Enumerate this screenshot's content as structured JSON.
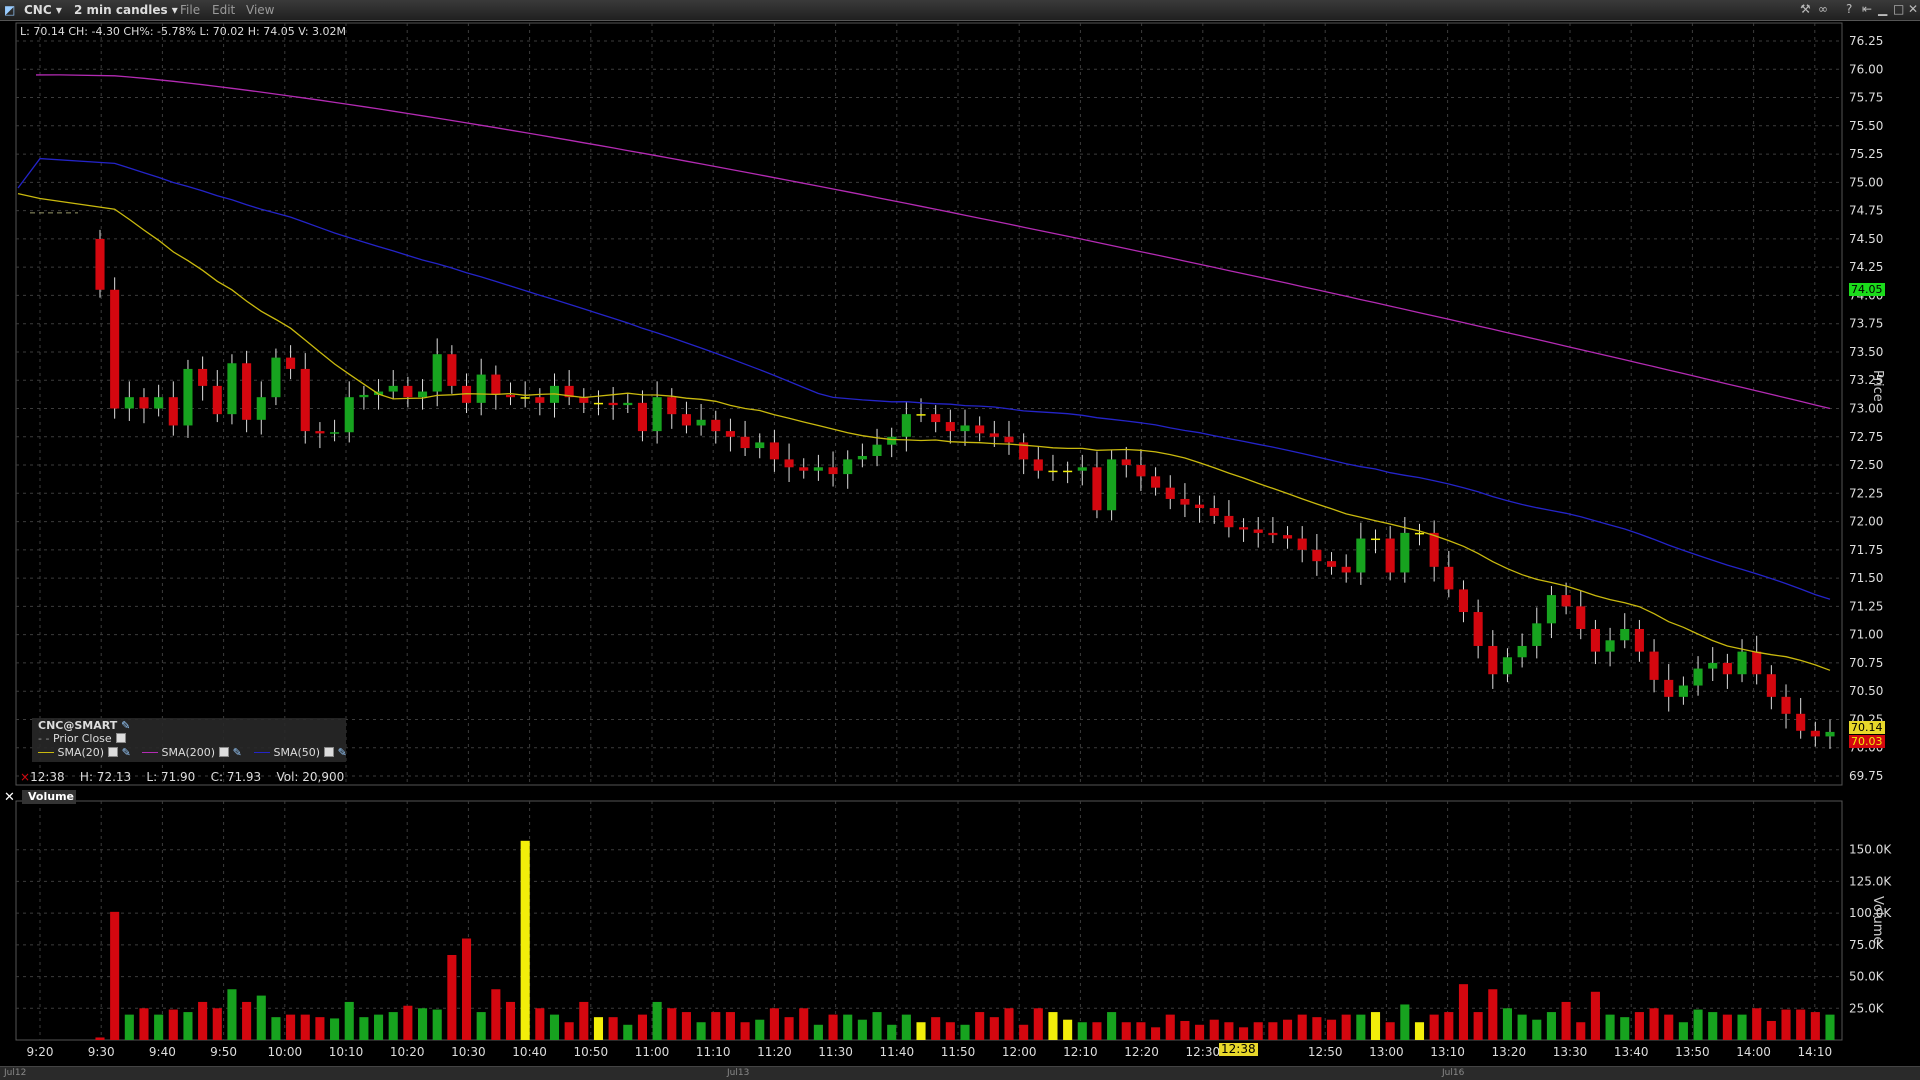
{
  "window": {
    "symbol": "CNC",
    "timeframe": "2 min candles",
    "menus": [
      "File",
      "Edit",
      "View"
    ]
  },
  "info_line": "L: 70.14 CH: -4.30 CH%: -5.78% L: 70.02 H: 74.05 V: 3.02M",
  "hover_line": {
    "time": "12:38",
    "high": "H: 72.13",
    "low": "L: 71.90",
    "close": "C: 71.93",
    "vol": "Vol: 20,900"
  },
  "legend": {
    "title": "CNC@SMART",
    "prior_close": "Prior Close",
    "sma20": "SMA(20)",
    "sma200": "SMA(200)",
    "sma50": "SMA(50)"
  },
  "volume_pane_title": "Volume",
  "axis_titles": {
    "price": "Price",
    "volume": "Volume"
  },
  "price_tags": {
    "high": "74.05",
    "last": "70.14",
    "low": "70.03"
  },
  "crosshair_time": "12:38",
  "date_labels": [
    "Jul12",
    "Jul13",
    "Jul16"
  ],
  "colors": {
    "up": "#17a31f",
    "down": "#d4070f",
    "unchanged": "#f2ee0a",
    "sma20": "#c9b90e",
    "sma50": "#2424c8",
    "sma200": "#b32bb3",
    "prior_close": "#9a9a6a",
    "grid": "#3c3c3c"
  },
  "chart_data": {
    "type": "candlestick",
    "price_axis": {
      "min": 69.75,
      "max": 76.25,
      "ticks": [
        "69.75",
        "70.00",
        "70.25",
        "70.50",
        "70.75",
        "71.00",
        "71.25",
        "71.50",
        "71.75",
        "72.00",
        "72.25",
        "72.50",
        "72.75",
        "73.00",
        "73.25",
        "73.50",
        "73.75",
        "74.00",
        "74.25",
        "74.50",
        "74.75",
        "75.00",
        "75.25",
        "75.50",
        "75.75",
        "76.00",
        "76.25"
      ]
    },
    "volume_axis": {
      "min": 0,
      "max": 160000,
      "ticks": [
        "25.0K",
        "50.0K",
        "75.0K",
        "100.0K",
        "125.0K",
        "150.0K"
      ]
    },
    "time_ticks": [
      "9:20",
      "9:30",
      "9:40",
      "9:50",
      "10:00",
      "10:10",
      "10:20",
      "10:30",
      "10:40",
      "10:50",
      "11:00",
      "11:10",
      "11:20",
      "11:30",
      "11:40",
      "11:50",
      "12:00",
      "12:10",
      "12:20",
      "12:30",
      "12:38",
      "12:50",
      "13:00",
      "13:10",
      "13:20",
      "13:30",
      "13:40",
      "13:50",
      "14:00",
      "14:10"
    ],
    "prior_close": 74.73,
    "closes": [
      74.05,
      73.0,
      73.1,
      73.0,
      73.1,
      72.85,
      73.35,
      73.2,
      72.95,
      73.4,
      72.9,
      73.1,
      73.45,
      73.35,
      72.8,
      72.78,
      72.79,
      73.1,
      73.12,
      73.15,
      73.2,
      73.1,
      73.15,
      73.48,
      73.2,
      73.05,
      73.3,
      73.12,
      73.1,
      73.1,
      73.05,
      73.2,
      73.1,
      73.05,
      73.05,
      73.03,
      73.05,
      72.8,
      73.1,
      72.95,
      72.85,
      72.9,
      72.8,
      72.75,
      72.65,
      72.7,
      72.55,
      72.48,
      72.45,
      72.48,
      72.42,
      72.55,
      72.58,
      72.68,
      72.75,
      72.95,
      72.95,
      72.88,
      72.8,
      72.85,
      72.78,
      72.75,
      72.7,
      72.55,
      72.45,
      72.45,
      72.45,
      72.48,
      72.1,
      72.55,
      72.5,
      72.4,
      72.3,
      72.2,
      72.15,
      72.12,
      72.05,
      71.95,
      71.93,
      71.9,
      71.88,
      71.85,
      71.75,
      71.65,
      71.6,
      71.55,
      71.85,
      71.85,
      71.55,
      71.9,
      71.9,
      71.6,
      71.4,
      71.2,
      70.9,
      70.65,
      70.8,
      70.9,
      71.1,
      71.35,
      71.25,
      71.05,
      70.85,
      70.95,
      71.05,
      70.85,
      70.6,
      70.45,
      70.55,
      70.7,
      70.75,
      70.65,
      70.85,
      70.65,
      70.45,
      70.3,
      70.15,
      70.1,
      70.14
    ],
    "volumes": [
      2000,
      101000,
      20000,
      25000,
      20000,
      24000,
      22000,
      30000,
      25000,
      40000,
      30000,
      35000,
      18000,
      20000,
      20000,
      18000,
      17000,
      30000,
      18000,
      20000,
      22000,
      27000,
      25000,
      24000,
      67000,
      80000,
      22000,
      40000,
      30000,
      157000,
      25000,
      20000,
      14000,
      30000,
      18000,
      18000,
      12000,
      20000,
      30000,
      25000,
      22000,
      14000,
      22000,
      22000,
      14000,
      16000,
      25000,
      18000,
      25000,
      12000,
      20000,
      20000,
      16000,
      22000,
      12000,
      20000,
      14000,
      18000,
      14000,
      12000,
      22000,
      18000,
      25000,
      12000,
      25000,
      22000,
      16000,
      14000,
      14000,
      22000,
      14000,
      14000,
      10000,
      20000,
      15000,
      12000,
      16000,
      14000,
      10000,
      14000,
      14000,
      16000,
      20000,
      18000,
      16000,
      20000,
      20000,
      22000,
      14000,
      28000,
      14000,
      20000,
      22000,
      44000,
      22000,
      40000,
      25000,
      20000,
      16000,
      22000,
      30000,
      14000,
      38000,
      20000,
      18000,
      22000,
      25000,
      20000,
      14000,
      24000,
      22000,
      20000,
      20000,
      25000,
      15000,
      24000,
      24000,
      22000,
      20000,
      25000,
      20000
    ]
  }
}
